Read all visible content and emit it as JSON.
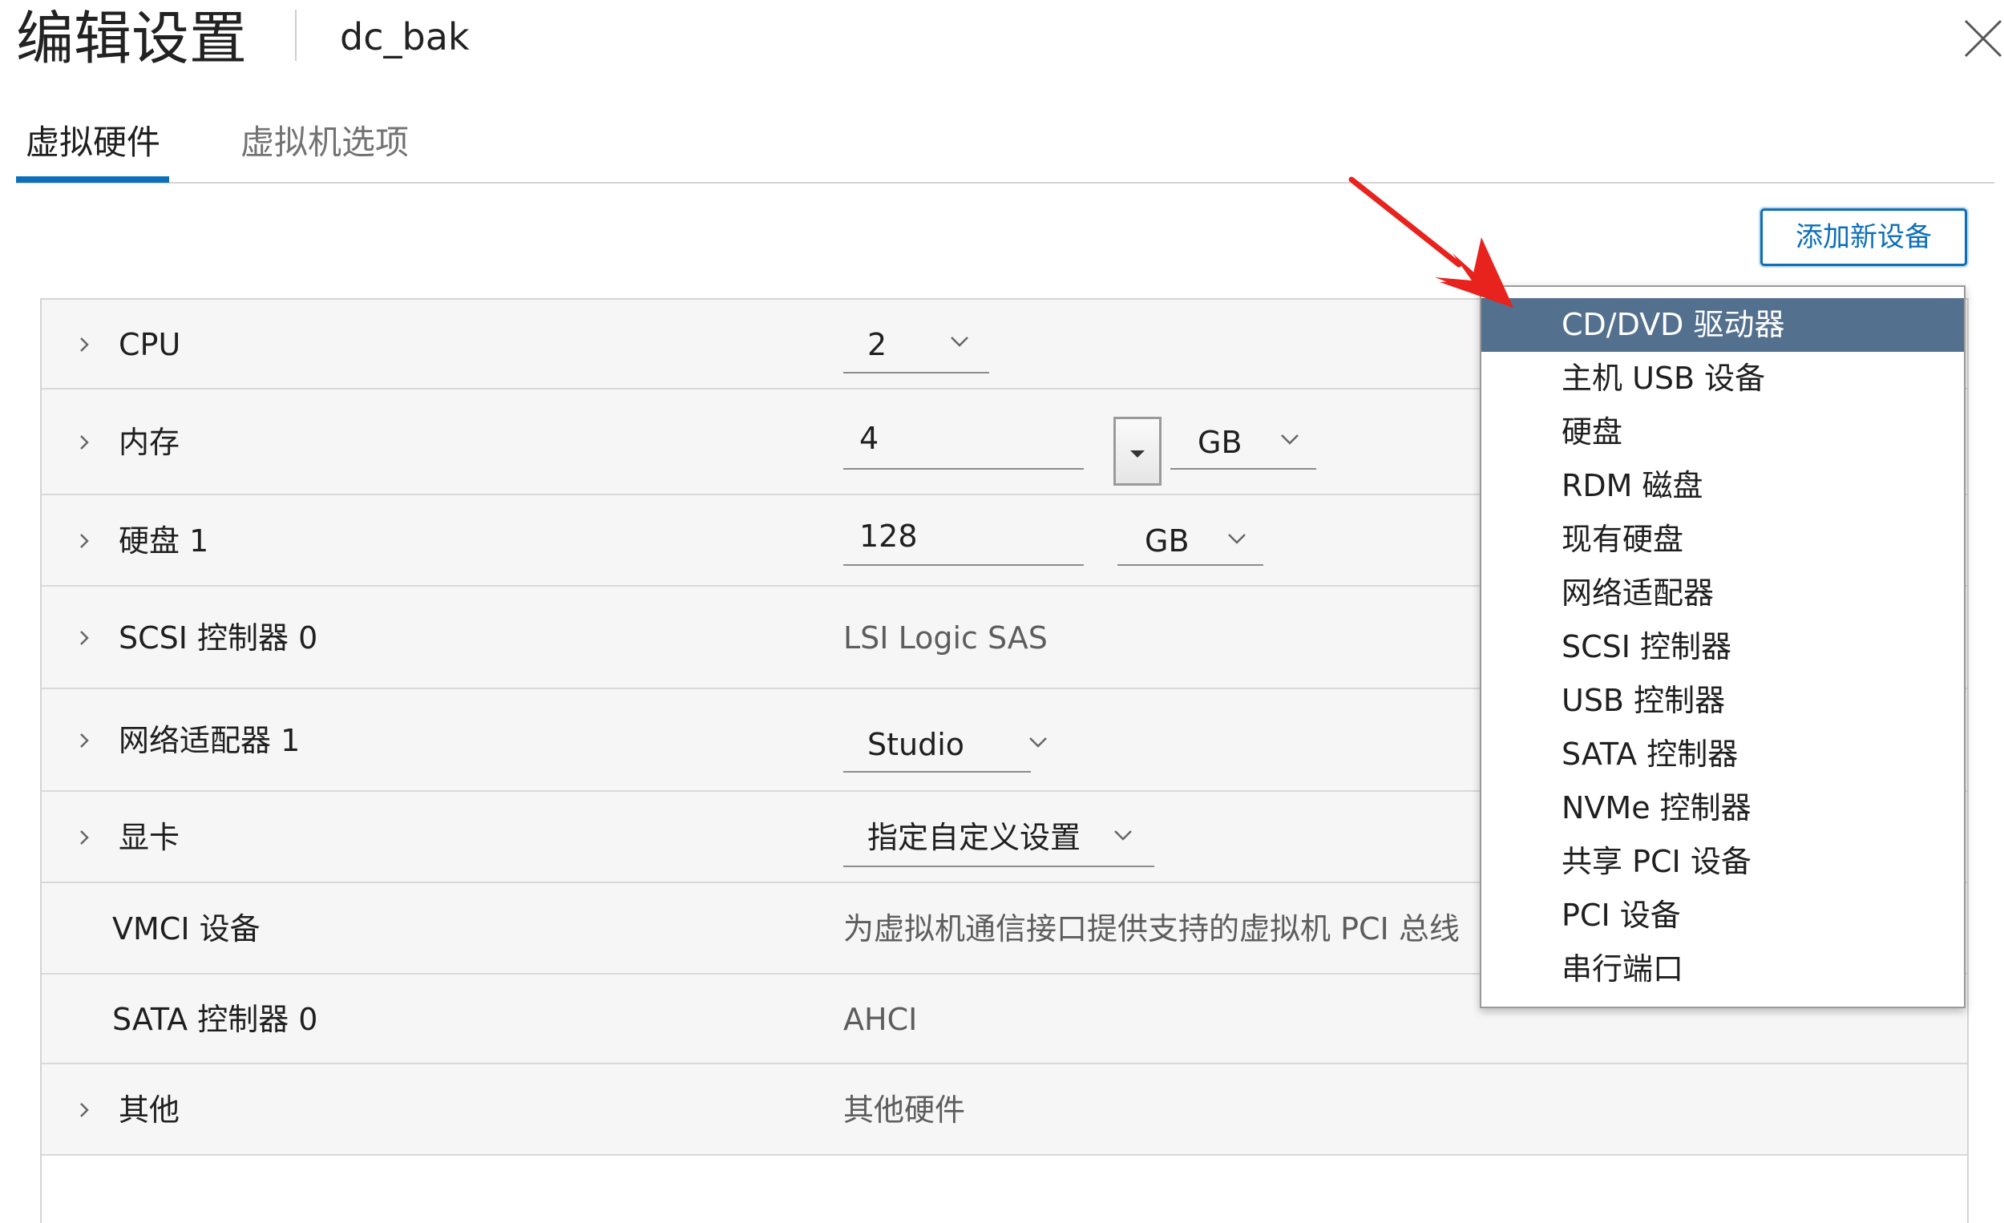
{
  "dialog": {
    "title": "编辑设置",
    "vm_name": "dc_bak"
  },
  "tabs": [
    {
      "label": "虚拟硬件",
      "active": true
    },
    {
      "label": "虚拟机选项",
      "active": false
    }
  ],
  "toolbar": {
    "add_device_label": "添加新设备"
  },
  "hardware": {
    "cpu": {
      "label": "CPU",
      "value": "2"
    },
    "memory": {
      "label": "内存",
      "value": "4",
      "unit": "GB"
    },
    "disk": {
      "label": "硬盘 1",
      "value": "128",
      "unit": "GB"
    },
    "scsi": {
      "label": "SCSI 控制器 0",
      "value": "LSI Logic SAS"
    },
    "network": {
      "label": "网络适配器 1",
      "value": "Studio"
    },
    "video": {
      "label": "显卡",
      "value": "指定自定义设置"
    },
    "vmci": {
      "label": "VMCI 设备",
      "value": "为虚拟机通信接口提供支持的虚拟机 PCI 总线"
    },
    "sata": {
      "label": "SATA 控制器 0",
      "value": "AHCI"
    },
    "other": {
      "label": "其他",
      "value": "其他硬件"
    }
  },
  "device_menu": {
    "items": [
      {
        "label": "CD/DVD 驱动器",
        "highlighted": true
      },
      {
        "label": "主机 USB 设备"
      },
      {
        "label": "硬盘"
      },
      {
        "label": "RDM 磁盘"
      },
      {
        "label": "现有硬盘"
      },
      {
        "label": "网络适配器"
      },
      {
        "label": "SCSI 控制器"
      },
      {
        "label": "USB 控制器"
      },
      {
        "label": "SATA 控制器"
      },
      {
        "label": "NVMe 控制器"
      },
      {
        "label": "共享 PCI 设备"
      },
      {
        "label": "PCI 设备"
      },
      {
        "label": "串行端口"
      }
    ]
  },
  "colors": {
    "accent": "#0c6fb8",
    "menu_highlight": "#53708f",
    "annotation_arrow": "#e8221c"
  }
}
